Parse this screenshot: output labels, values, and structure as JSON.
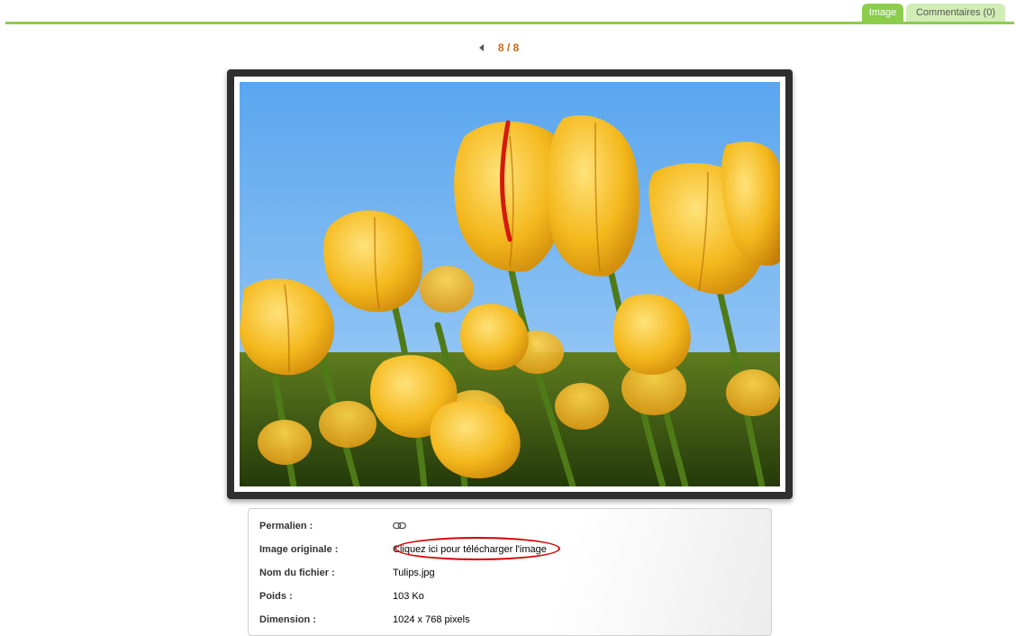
{
  "tabs": {
    "image_label": "Image",
    "comments_label": "Commentaires (0)"
  },
  "navigation": {
    "counter": "8 / 8",
    "prev_icon": "triangle-left-icon"
  },
  "photo": {
    "subject": "yellow-tulips"
  },
  "details": {
    "permalink": {
      "label": "Permalien :",
      "icon": "chain-link-icon"
    },
    "original": {
      "label": "Image originale :",
      "value": "Cliquez ici pour télécharger l'image"
    },
    "filename": {
      "label": "Nom du fichier :",
      "value": "Tulips.jpg"
    },
    "size": {
      "label": "Poids :",
      "value": "103 Ko"
    },
    "dimension": {
      "label": "Dimension :",
      "value": "1024 x 768 pixels"
    }
  },
  "colors": {
    "accent_green": "#8ccd4c",
    "counter_orange": "#c66a12",
    "annotation_red": "#d40000"
  }
}
